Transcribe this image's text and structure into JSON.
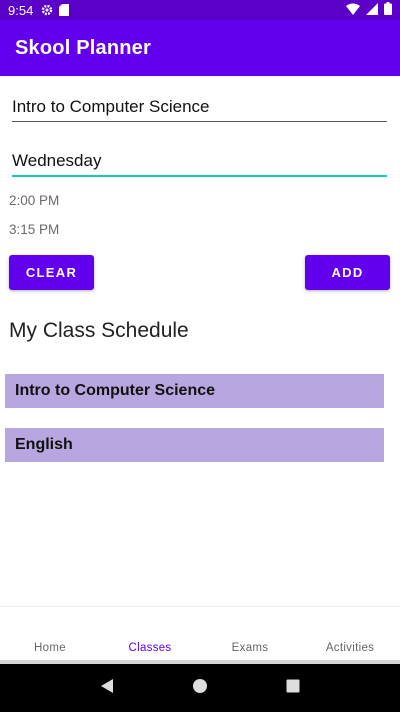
{
  "status_bar": {
    "time": "9:54",
    "icons": [
      "settings-icon",
      "sd-card-icon",
      "wifi-icon",
      "signal-icon",
      "battery-icon"
    ]
  },
  "app_bar": {
    "title": "Skool Planner"
  },
  "form": {
    "class_name_value": "Intro to Computer Science",
    "day_value": "Wednesday",
    "start_time": "2:00 PM",
    "end_time": "3:15 PM",
    "clear_label": "CLEAR",
    "add_label": "ADD"
  },
  "schedule": {
    "title": "My Class Schedule",
    "items": [
      {
        "label": "Intro to Computer Science"
      },
      {
        "label": "English"
      }
    ]
  },
  "bottom_nav": {
    "items": [
      {
        "label": "Home"
      },
      {
        "label": "Classes"
      },
      {
        "label": "Exams"
      },
      {
        "label": "Activities"
      }
    ],
    "active": "Classes"
  },
  "system_nav": {
    "icons": [
      "back-icon",
      "home-icon",
      "recents-icon"
    ]
  },
  "colors": {
    "primary": "#6200ee",
    "status_bar": "#5a00c8",
    "schedule_item_bg": "#b7a6df",
    "focus_underline": "#18c9c0"
  }
}
